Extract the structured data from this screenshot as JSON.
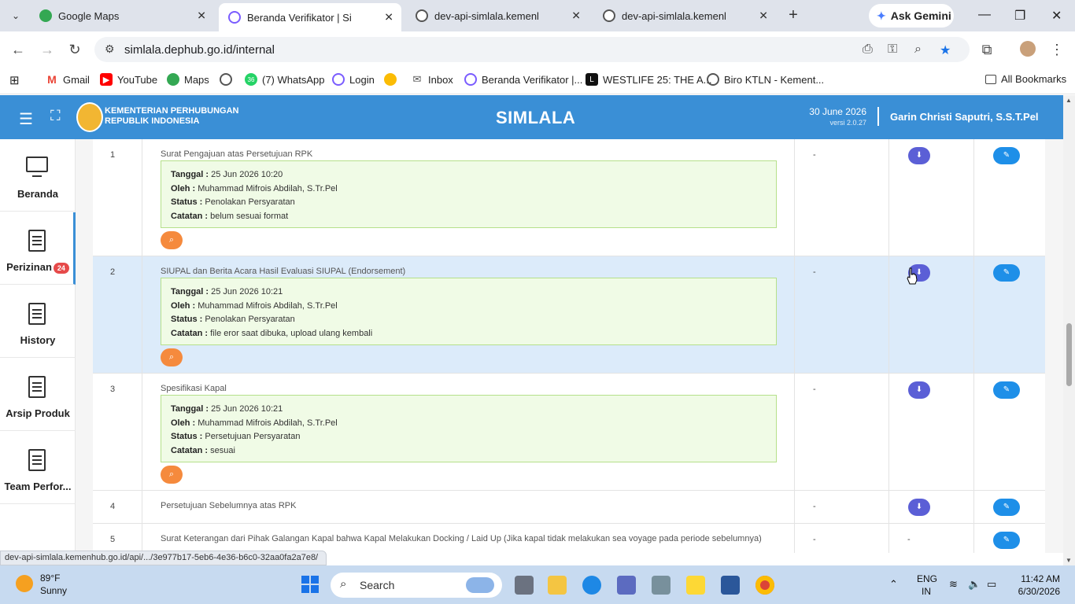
{
  "browser": {
    "tabs": [
      {
        "title": "Google Maps",
        "favicon": "maps-pin-icon",
        "active": false
      },
      {
        "title": "Beranda Verifikator | SimLala",
        "favicon": "globe-icon",
        "active": true
      },
      {
        "title": "dev-api-simlala.kemenhub.go.id",
        "favicon": "globe-icon",
        "active": false
      },
      {
        "title": "dev-api-simlala.kemenhub.go.id",
        "favicon": "globe-icon",
        "active": false
      }
    ],
    "new_tab": "+",
    "ask_gemini": "Ask Gemini",
    "url": "simlala.dephub.go.id/internal",
    "bookmarks": [
      {
        "label": "Gmail"
      },
      {
        "label": "YouTube"
      },
      {
        "label": "Maps"
      },
      {
        "label": ""
      },
      {
        "label": "(7) WhatsApp",
        "badge": "36"
      },
      {
        "label": "Login"
      },
      {
        "label": ""
      },
      {
        "label": "Inbox"
      },
      {
        "label": "Beranda Verifikator |..."
      },
      {
        "label": "WESTLIFE 25: THE A..."
      },
      {
        "label": "Biro KTLN - Kement..."
      }
    ],
    "all_bookmarks": "All Bookmarks",
    "status_url": "dev-api-simlala.kemenhub.go.id/api/.../3e977b17-5eb6-4e36-b6c0-32aa0fa2a7e8/"
  },
  "app": {
    "org_line1": "KEMENTERIAN PERHUBUNGAN",
    "org_line2": "REPUBLIK INDONESIA",
    "title": "SIMLALA",
    "date": "30 June 2026",
    "version": "versi 2.0.27",
    "user": "Garin Christi Saputri, S.S.T.Pel",
    "accent_color": "#3a8fd6"
  },
  "sidebar": {
    "items": [
      {
        "label": "Beranda",
        "icon": "monitor-icon"
      },
      {
        "label": "Perizinan",
        "icon": "document-icon",
        "badge": "24",
        "active": true
      },
      {
        "label": "History",
        "icon": "document-icon"
      },
      {
        "label": "Arsip Produk",
        "icon": "document-icon"
      },
      {
        "label": "Team Perfor...",
        "icon": "document-icon"
      }
    ]
  },
  "labels": {
    "tanggal": "Tanggal :",
    "oleh": "Oleh :",
    "status": "Status :",
    "catatan": "Catatan :"
  },
  "documents": [
    {
      "no": "1",
      "title": "Surat Pengajuan atas Persetujuan RPK",
      "tanggal": "25 Jun 2026 10:20",
      "oleh": "Muhammad Mifrois Abdilah, S.Tr.Pel",
      "status": "Penolakan Persyaratan",
      "catatan": "belum sesuai format",
      "col3": "-"
    },
    {
      "no": "2",
      "title": "SIUPAL dan Berita Acara Hasil Evaluasi SIUPAL (Endorsement)",
      "tanggal": "25 Jun 2026 10:21",
      "oleh": "Muhammad Mifrois Abdilah, S.Tr.Pel",
      "status": "Penolakan Persyaratan",
      "catatan": "file eror saat dibuka, upload ulang kembali",
      "col3": "-"
    },
    {
      "no": "3",
      "title": "Spesifikasi Kapal",
      "tanggal": "25 Jun 2026 10:21",
      "oleh": "Muhammad Mifrois Abdilah, S.Tr.Pel",
      "status": "Persetujuan Persyaratan",
      "catatan": "sesuai",
      "col3": "-"
    },
    {
      "no": "4",
      "title": "Persetujuan Sebelumnya atas RPK",
      "col3": "-"
    },
    {
      "no": "5",
      "title": "Surat Keterangan dari Pihak Galangan Kapal bahwa Kapal Melakukan Docking / Laid Up (Jika kapal tidak melakukan sea voyage pada periode sebelumnya)",
      "col3": "-",
      "download": "-"
    }
  ],
  "taskbar": {
    "temp": "89°F",
    "weather": "Sunny",
    "search_placeholder": "Search",
    "lang1": "ENG",
    "lang2": "IN",
    "time": "11:42 AM",
    "date": "6/30/2026"
  }
}
